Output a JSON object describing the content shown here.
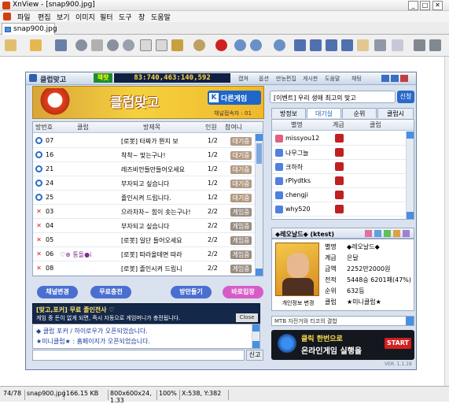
{
  "window": {
    "title": "XnView - [snap900.jpg]"
  },
  "menu": [
    "파일",
    "편집",
    "보기",
    "이미지",
    "필터",
    "도구",
    "창",
    "도움말"
  ],
  "tab": {
    "label": "snap900.jpg"
  },
  "toolbar_icons": [
    "open-dropdown-icon",
    "browse-folder-icon",
    "save-icon",
    "undo-icon",
    "cut-icon",
    "redo-icon",
    "copy-icon",
    "paste-icon",
    "wand-icon",
    "settings-icon",
    "record-icon",
    "zoom-in-icon",
    "zoom-menu-icon",
    "zoom-out-icon",
    "prev-icon",
    "next-icon",
    "first-icon",
    "last-icon",
    "hand-icon",
    "view-icon",
    "page-icon",
    "options-icon",
    "exit-icon"
  ],
  "status": {
    "index": "74/78",
    "filename": "snap900.jpg",
    "filesize": "166.15 KB",
    "dims": "800x600x24, 1.33",
    "zoom": "100%",
    "coords": "X:538, Y:382"
  },
  "game": {
    "title": "클럽맞고",
    "money_label": "잭팟",
    "money": "83:740,463:140,592",
    "header_links": [
      "캡쳐",
      "옵션",
      "만능편집",
      "게시판",
      "도움말",
      "채팅"
    ],
    "banner_title": "클럽맞고",
    "other_game": "다른게임",
    "user_count_label": "채널접속자 : 01",
    "notice_input": "[이벤트] 우리 생애 최고의 맞고",
    "notice_btn": "신청",
    "room_columns": [
      "방번호",
      "클럽",
      "방제목",
      "인원",
      "참여니"
    ],
    "rooms": [
      {
        "no": "07",
        "club": "",
        "title": "[로봇] 타짜가 뭔지 보",
        "count": "1/2",
        "state": "대기중",
        "open": true
      },
      {
        "no": "16",
        "club": "",
        "title": "착착~ 맞는구나!",
        "count": "1/2",
        "state": "대기중",
        "open": true
      },
      {
        "no": "21",
        "club": "",
        "title": "레즈비언들만들어오세요",
        "count": "1/2",
        "state": "대기중",
        "open": true
      },
      {
        "no": "24",
        "club": "",
        "title": "부자되고 싶습니다",
        "count": "1/2",
        "state": "대기중",
        "open": true
      },
      {
        "no": "25",
        "club": "",
        "title": "졸인시켜 드립니다.",
        "count": "1/2",
        "state": "대기중",
        "open": true
      },
      {
        "no": "03",
        "club": "",
        "title": "으라차차~ 힘이 솟는구나!",
        "count": "2/2",
        "state": "게임중",
        "open": false
      },
      {
        "no": "04",
        "club": "",
        "title": "부자되고 싶습니다",
        "count": "2/2",
        "state": "게임중",
        "open": false
      },
      {
        "no": "05",
        "club": "",
        "title": "[로봇] 일단 들어오세요",
        "count": "2/2",
        "state": "게임중",
        "open": false
      },
      {
        "no": "06",
        "club": "♡⊕ 통돌●i",
        "title": "[로봇] 따라올테면 따라",
        "count": "2/2",
        "state": "게임중",
        "open": false
      },
      {
        "no": "08",
        "club": "",
        "title": "[로봇] 졸인시켜 드립니",
        "count": "2/2",
        "state": "게임중",
        "open": false
      }
    ],
    "room_buttons": [
      "채널변경",
      "무료충전",
      "방만들기",
      "바로입장"
    ],
    "chat_banner_title": "[맞고,포커] 무료 졸인전사 ♡",
    "chat_banner_text": "게임 중 돈이 없게 되면, 즉시 자동으로 게임머니가 충전됩니다.",
    "chat_banner_close": "Close",
    "chat_lines": [
      "◆ 클럽 포커 / 하이로우가 오픈되었습니다.",
      "★미니클럽★ : 홈페이지가 오픈되었습니다."
    ],
    "chat_send": "신고",
    "player_tabs": [
      "방정보",
      "대기실",
      "순위",
      "클럽시"
    ],
    "player_columns": [
      "별명",
      "계급",
      "클럽"
    ],
    "players": [
      {
        "name": "missyou12",
        "color": "#e06080"
      },
      {
        "name": "나무그늘",
        "color": "#5080e0"
      },
      {
        "name": "크하하",
        "color": "#5080e0"
      },
      {
        "name": "rPlydtks",
        "color": "#5080e0"
      },
      {
        "name": "chengji",
        "color": "#5080e0"
      },
      {
        "name": "why520",
        "color": "#5080e0"
      }
    ],
    "profile": {
      "name_head": "◆레오날드◆ (ktest)",
      "caption": "개인정보 변경",
      "labels": [
        "별명",
        "계급",
        "금액",
        "전적",
        "순위",
        "클럽"
      ],
      "values": [
        "◆레오날드◆",
        "은달",
        "2252만2000원",
        "5448승 6201패(47%)",
        "632등",
        "★미니클럽★"
      ]
    },
    "promo_select": "MTB 자전거와 티코의 결합",
    "ad_line1": "클릭 한번으로",
    "ad_line2": "온라인게임 실행을",
    "ad_start": "START",
    "version": "VER. 1.1.19"
  },
  "colors": {
    "accent": "#1a5bb8",
    "game_bg": "#d9e2ee",
    "pill_blue": "#4a6fd0",
    "pill_pink": "#d85cc8"
  }
}
